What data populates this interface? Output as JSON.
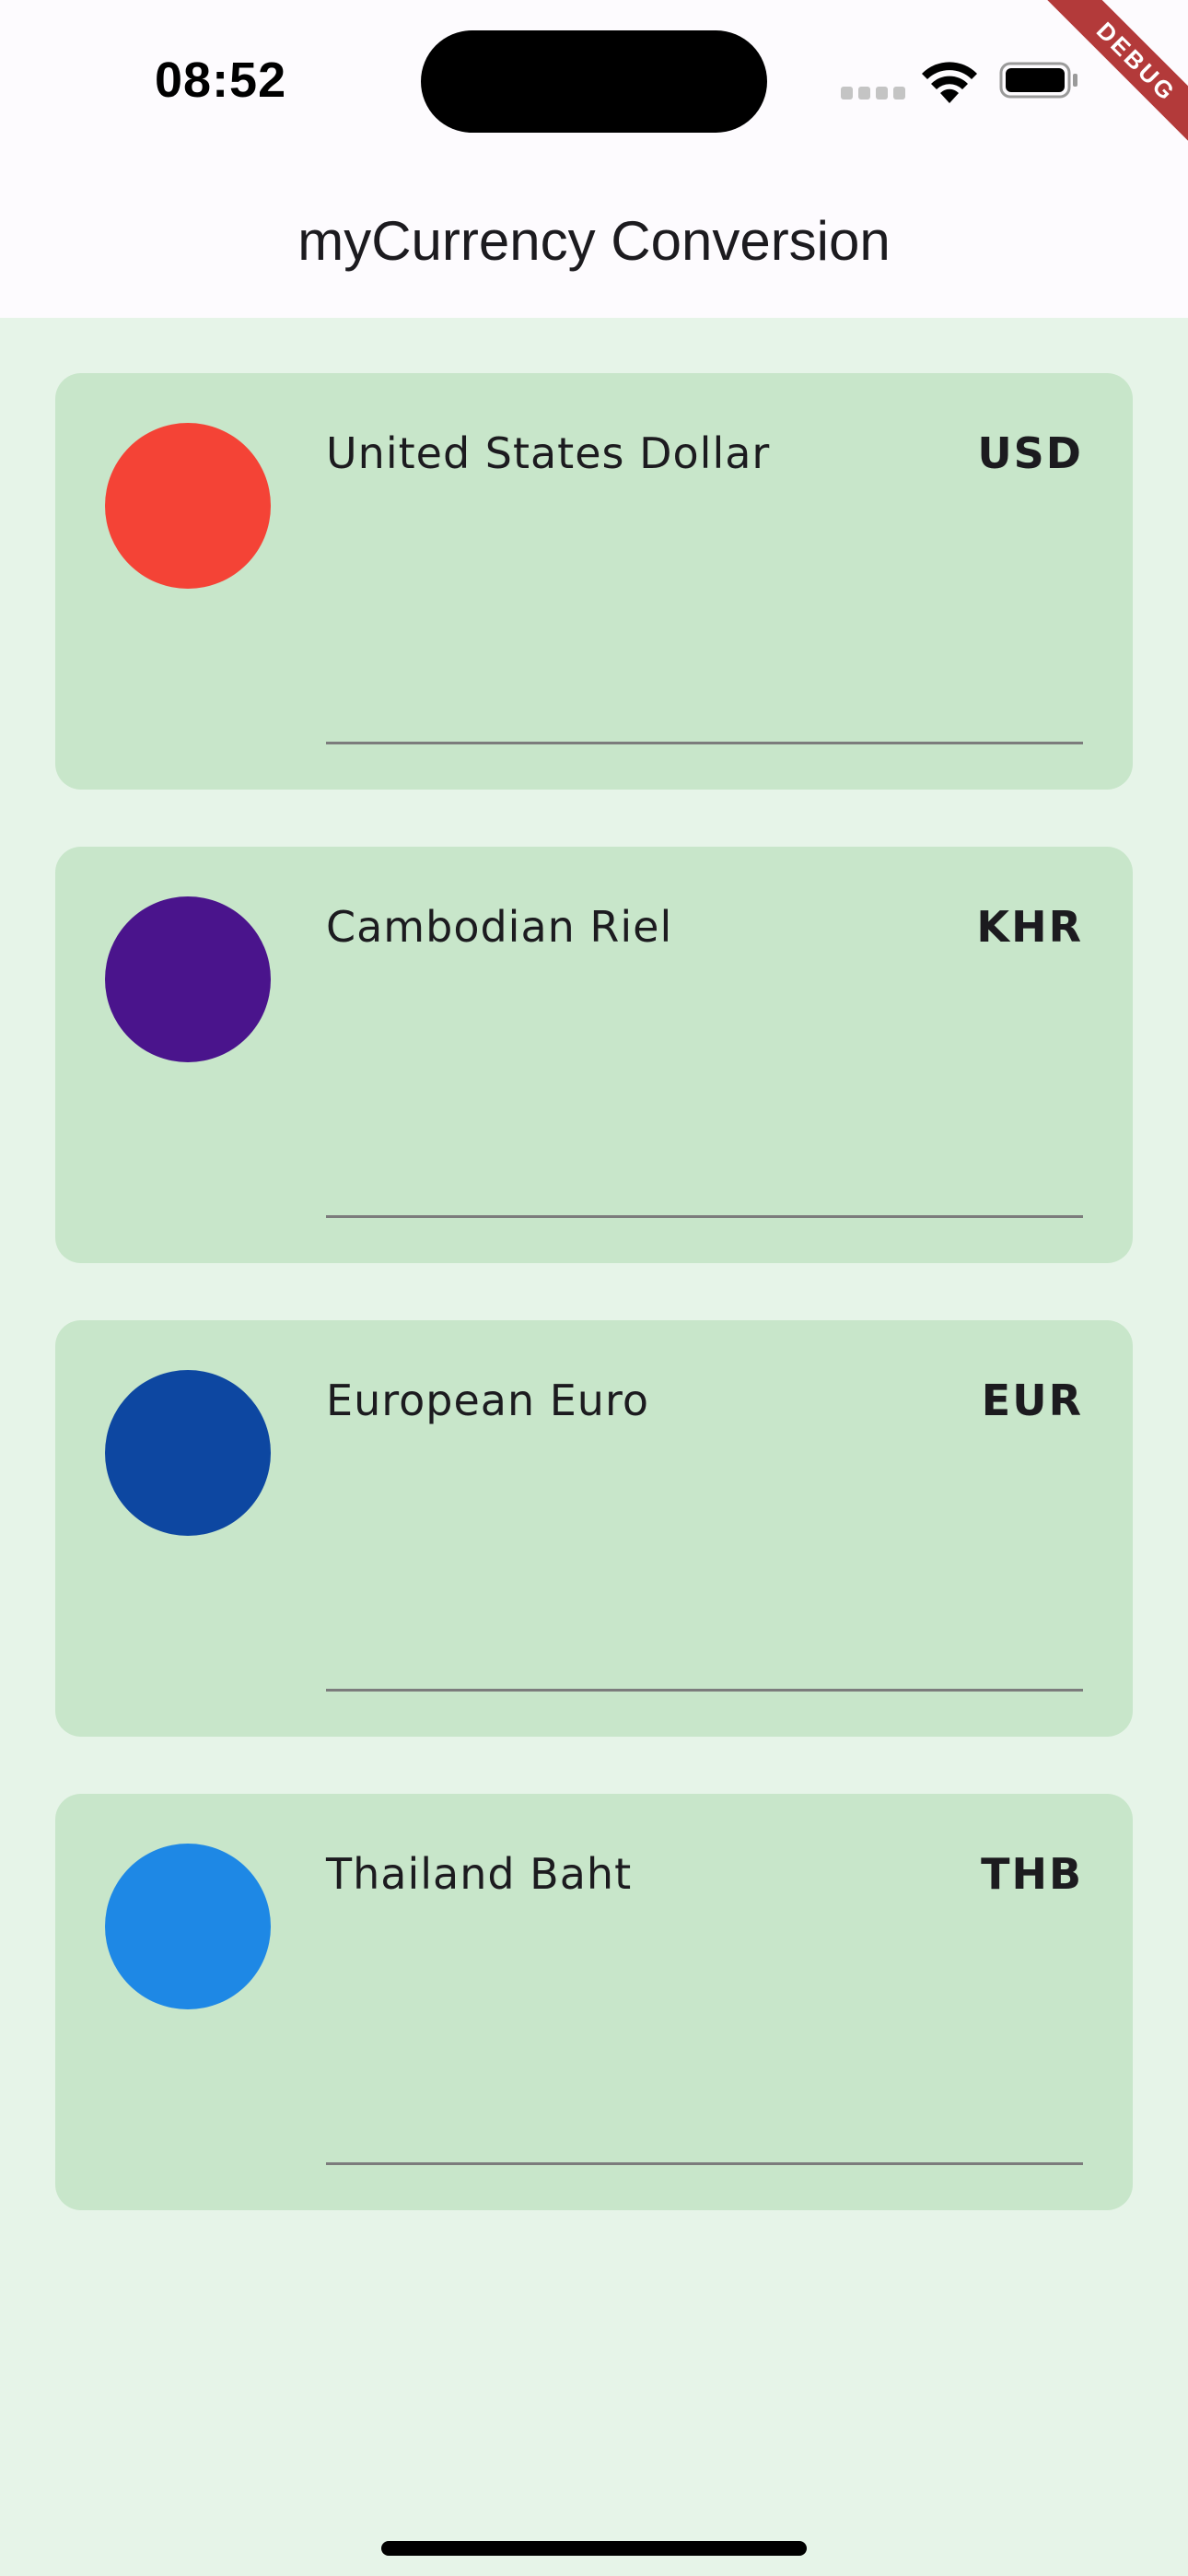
{
  "status_bar": {
    "time": "08:52"
  },
  "debug_banner": {
    "label": "DEBUG"
  },
  "app_bar": {
    "title": "myCurrency Conversion"
  },
  "currencies": [
    {
      "name": "United States Dollar",
      "code": "USD",
      "color": "#f44336",
      "amount": ""
    },
    {
      "name": "Cambodian Riel",
      "code": "KHR",
      "color": "#4a148c",
      "amount": ""
    },
    {
      "name": "European Euro",
      "code": "EUR",
      "color": "#0d47a1",
      "amount": ""
    },
    {
      "name": "Thailand Baht",
      "code": "THB",
      "color": "#1e88e5",
      "amount": ""
    }
  ]
}
